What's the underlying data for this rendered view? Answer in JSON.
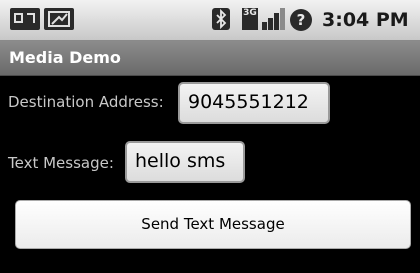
{
  "status_bar": {
    "time": "3:04 PM",
    "network_label": "3G",
    "alert_glyph": "?",
    "icons": [
      "notification-icon",
      "missed-call-icon",
      "bluetooth-icon",
      "network-3g-icon",
      "signal-strength-icon",
      "alert-icon"
    ]
  },
  "app": {
    "title": "Media Demo"
  },
  "form": {
    "destination_label": "Destination Address:",
    "destination_value": "9045551212",
    "message_label": "Text Message:",
    "message_value": "hello sms",
    "send_label": "Send Text Message"
  },
  "colors": {
    "background": "#000000",
    "status_bar": "#d8d8d8",
    "title_bar": "#7a7a7a",
    "label_text": "#c8c8c8"
  }
}
